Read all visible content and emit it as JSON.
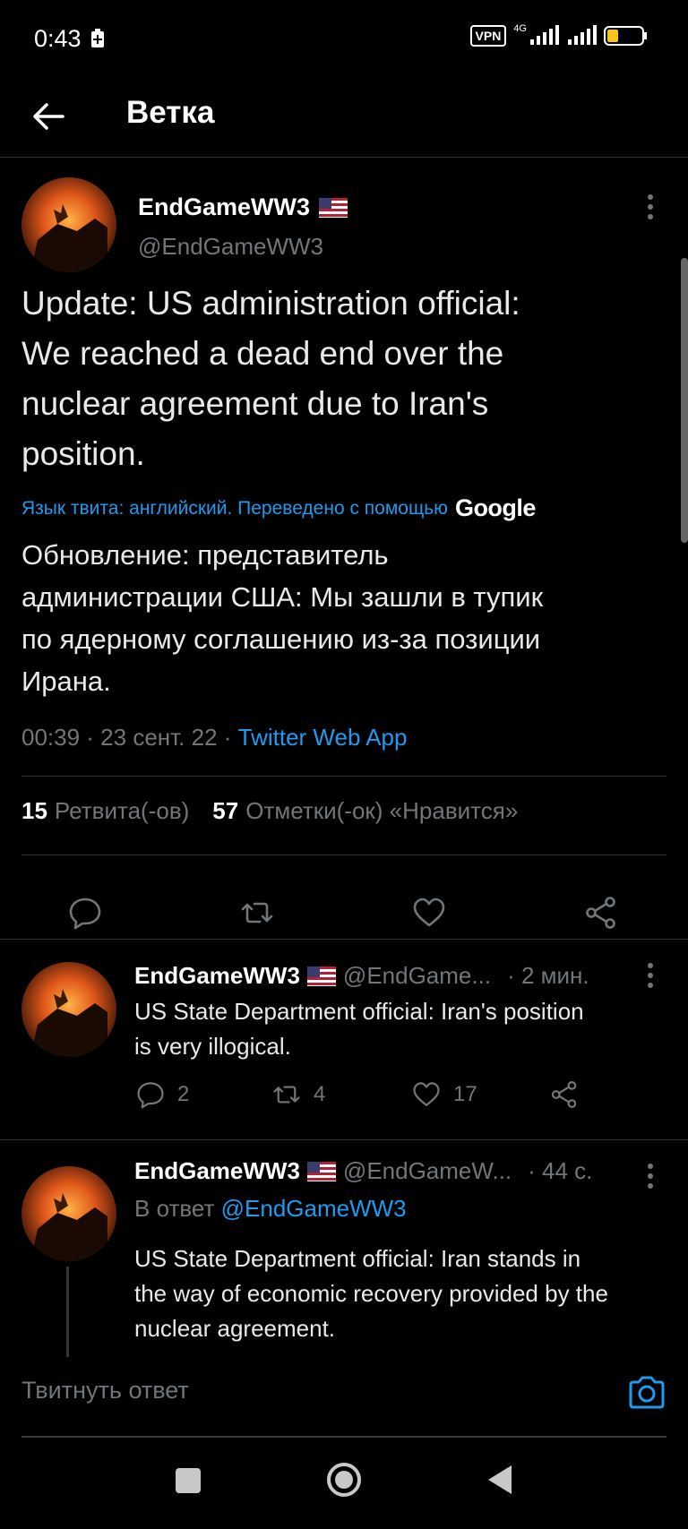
{
  "status": {
    "time": "0:43",
    "vpn": "VPN",
    "network": "4G"
  },
  "header": {
    "title": "Ветка"
  },
  "main_tweet": {
    "author_name": "EndGameWW3",
    "author_handle": "@EndGameWW3",
    "text_lines": [
      "Update: US administration official:",
      "We reached a dead end over the",
      "nuclear agreement due to Iran's",
      "position."
    ],
    "translate_label": "Язык твита: английский. Переведено с помощью",
    "translate_provider": "Google",
    "translation_lines": [
      "Обновление: представитель",
      "администрации США: Мы зашли в тупик",
      "по ядерному соглашению из-за позиции",
      "Ирана."
    ],
    "meta_time": "00:39 · 23 сент. 22 · ",
    "meta_source": "Twitter Web App",
    "retweets_count": "15",
    "retweets_label": "Ретвита(-ов)",
    "likes_count": "57",
    "likes_label": "Отметки(-ок) «Нравится»"
  },
  "replies": [
    {
      "name": "EndGameWW3",
      "handle": "@EndGame...",
      "time": "· 2 мин.",
      "text_lines": [
        "US State Department official: Iran's position",
        "is very illogical."
      ],
      "reply_count": "2",
      "retweet_count": "4",
      "like_count": "17"
    },
    {
      "name": "EndGameWW3",
      "handle": "@EndGameW...",
      "time": "· 44 с.",
      "reply_to_prefix": "В ответ",
      "reply_to_mention": "@EndGameWW3",
      "text_lines": [
        "US State Department official: Iran stands in",
        "the way of economic recovery provided by the",
        "nuclear agreement."
      ]
    }
  ],
  "composer": {
    "placeholder": "Твитнуть ответ"
  },
  "colors": {
    "accent": "#1d9bf0",
    "muted": "#71767b",
    "background": "#000000",
    "text": "#e7e9ea"
  },
  "icons": {
    "back": "arrow-left-icon",
    "more": "more-vertical-icon",
    "reply": "reply-bubble-icon",
    "retweet": "retweet-icon",
    "like": "heart-icon",
    "share": "share-icon",
    "camera": "camera-icon"
  }
}
